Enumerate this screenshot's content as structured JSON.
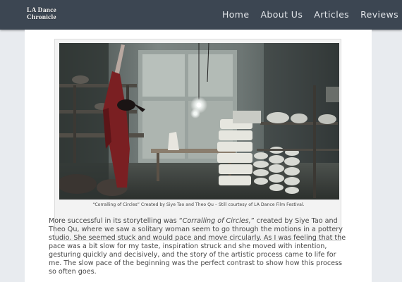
{
  "site": {
    "logo_line1": "LA Dance",
    "logo_line2": "Chronicle"
  },
  "nav": {
    "items": [
      "Home",
      "About Us",
      "Articles",
      "Reviews"
    ]
  },
  "figure": {
    "caption": "“Corralling of Circles” Created by Siye Tao and Theo Qu – Still courtesy of LA Dance Film Festival.",
    "image_subject": "dancer in a pottery studio with stacked white ceramics and hanging light bulbs"
  },
  "article": {
    "p1_before": "More successful in its storytelling was “",
    "p1_title": "Corralling of Circles,",
    "p1_after": "” created by Siye Tao and Theo Qu, where we saw a solitary woman seem to go through the motions in a pottery studio. She seemed stuck and would pace and move circularly. As I was feeling that the pace was a bit slow for my taste, inspiration struck and she moved with intention, gesturing quickly and decisively, and the story of the artistic process came to life for me. The slow pace of the beginning was the perfect contrast to show how this process so often goes."
  },
  "colors": {
    "navbar": "#3c4652",
    "page_background": "#e8ebef",
    "content_background": "#ffffff",
    "body_text": "#474747"
  }
}
